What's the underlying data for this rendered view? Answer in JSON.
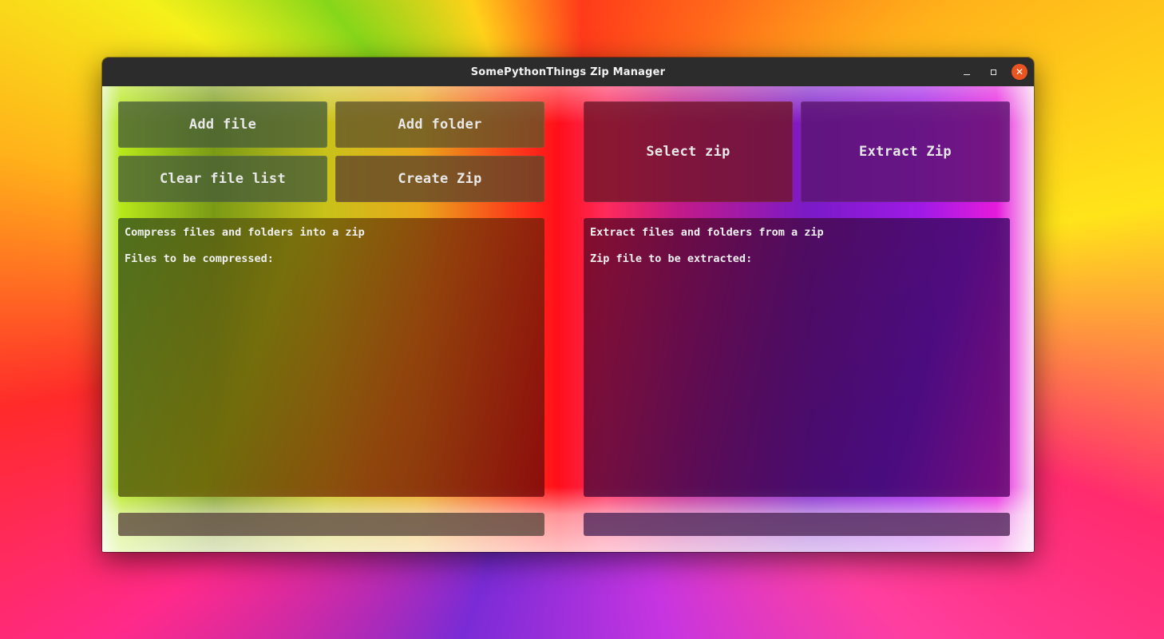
{
  "window": {
    "title": "SomePythonThings Zip Manager"
  },
  "titlebar_controls": {
    "minimize_icon": "minimize-icon",
    "maximize_icon": "maximize-icon",
    "close_icon": "close-icon",
    "close_glyph": "✕"
  },
  "compress": {
    "add_file_label": "Add file",
    "add_folder_label": "Add folder",
    "clear_file_list_label": "Clear file list",
    "create_zip_label": "Create Zip",
    "info_heading": "Compress files and folders into a zip",
    "info_list_label": "Files to be compressed:",
    "progress": 0
  },
  "extract": {
    "select_zip_label": "Select zip",
    "extract_zip_label": "Extract Zip",
    "info_heading": "Extract files and folders from a zip",
    "info_file_label": "Zip file to be extracted:",
    "progress": 0
  },
  "colors": {
    "titlebar": "#2c2c2c",
    "close_button": "#e95420"
  }
}
